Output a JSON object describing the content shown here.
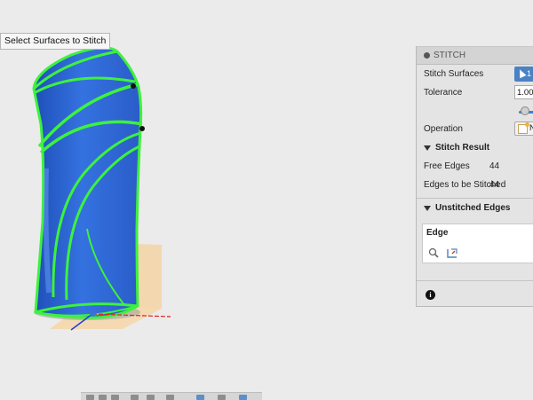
{
  "tooltip": {
    "text": "Select Surfaces to Stitch"
  },
  "panel": {
    "title": "STITCH",
    "stitch_surfaces": {
      "label": "Stitch Surfaces",
      "count": "1"
    },
    "tolerance": {
      "label": "Tolerance",
      "value": "1.00"
    },
    "operation": {
      "label": "Operation",
      "value": "N"
    },
    "stitch_result": {
      "title": "Stitch Result",
      "free_edges": {
        "label": "Free Edges",
        "value": "44"
      },
      "edges_to_stitch": {
        "label": "Edges to be Stitched",
        "value": "44"
      }
    },
    "unstitched": {
      "title": "Unstitched Edges",
      "column": "Edge"
    }
  },
  "colors": {
    "surface_blue": "#2f64d6",
    "selection_green": "#3df23d",
    "accent": "#4a82c4"
  }
}
